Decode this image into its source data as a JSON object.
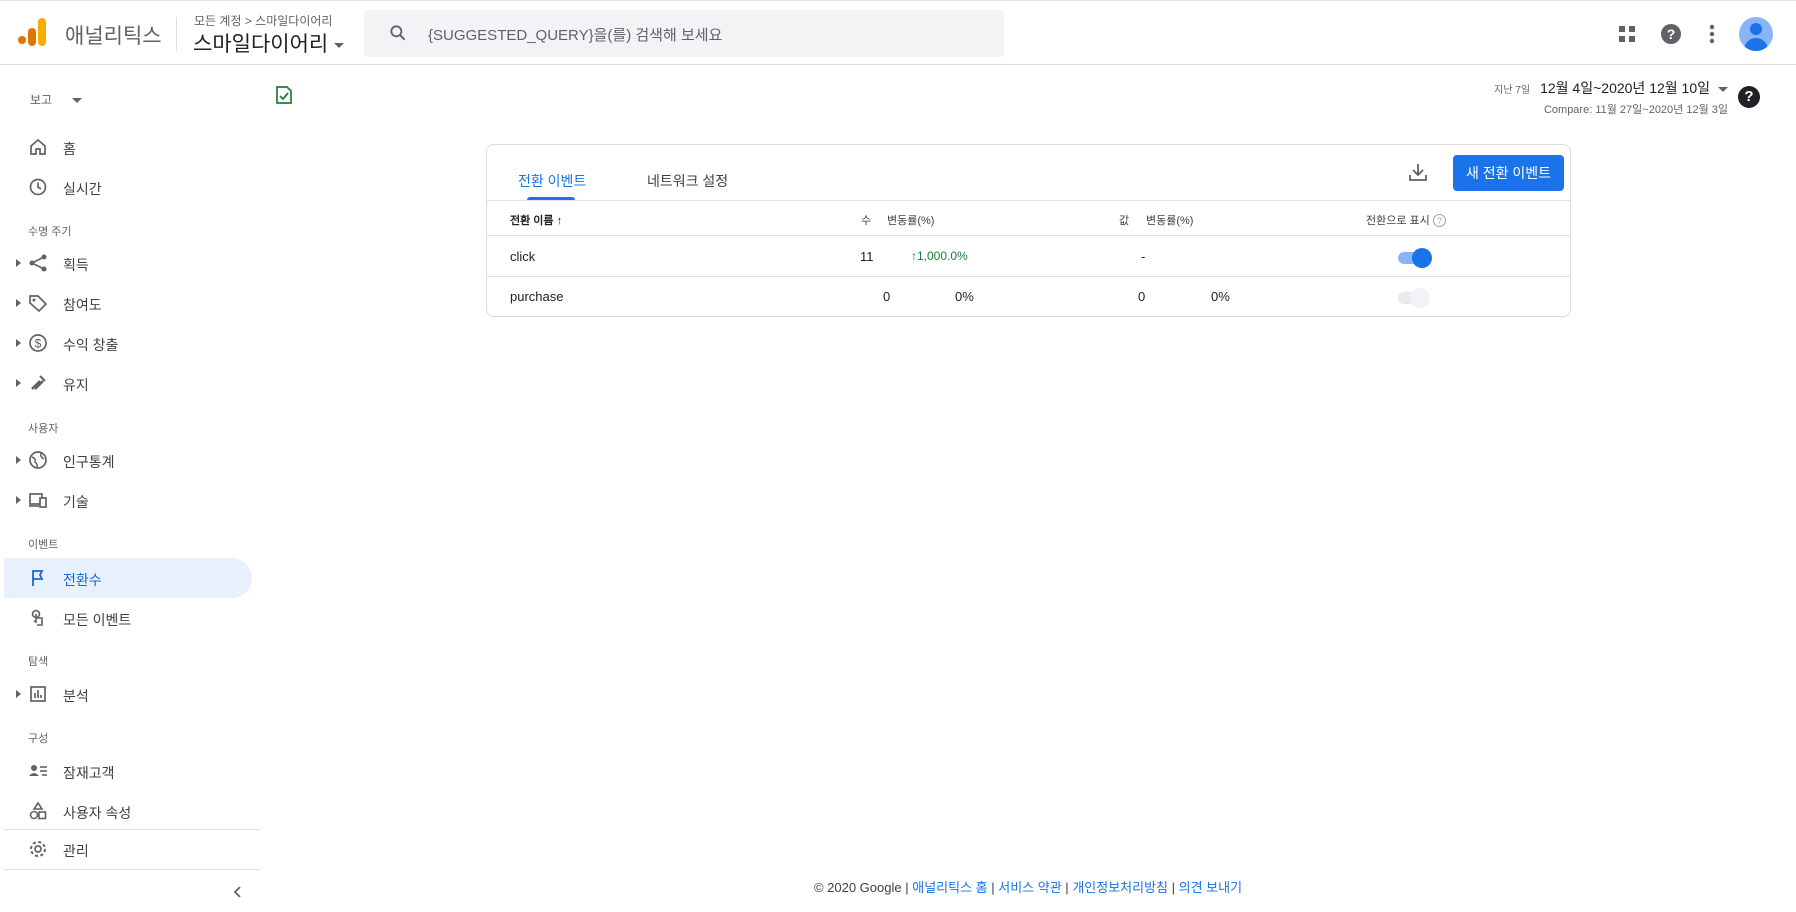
{
  "header": {
    "app_name": "애널리틱스",
    "breadcrumb": "모든 계정 > 스마일다이어리",
    "property": "스마일다이어리",
    "search_placeholder": "{SUGGESTED_QUERY}을(를) 검색해 보세요"
  },
  "sidebar": {
    "report_label": "보고",
    "home": "홈",
    "realtime": "실시간",
    "section_lifecycle": "수명 주기",
    "acquisition": "획득",
    "engagement": "참여도",
    "monetization": "수익 창출",
    "retention": "유지",
    "section_user": "사용자",
    "demographics": "인구통계",
    "tech": "기술",
    "section_events": "이벤트",
    "conversions": "전환수",
    "all_events": "모든 이벤트",
    "section_explore": "탐색",
    "analysis": "분석",
    "section_configure": "구성",
    "audiences": "잠재고객",
    "user_properties": "사용자 속성",
    "admin": "관리"
  },
  "date": {
    "range_label": "지난 7일",
    "range": "12월 4일~2020년 12월 10일",
    "compare": "Compare: 11월 27일~2020년 12월 3일"
  },
  "card": {
    "tab_conversions": "전환 이벤트",
    "tab_network": "네트워크 설정",
    "new_button": "새 전환 이벤트",
    "columns": {
      "name": "전환 이름",
      "count": "수",
      "change1": "변동률(%)",
      "value": "값",
      "change2": "변동률(%)",
      "mark": "전환으로 표시"
    },
    "rows": [
      {
        "name": "click",
        "count": "11",
        "change1": "1,000.0%",
        "value": "-",
        "change2": "",
        "marked": true
      },
      {
        "name": "purchase",
        "count": "0",
        "change1": "0%",
        "value": "0",
        "change2": "0%",
        "marked": false
      }
    ]
  },
  "footer": {
    "copyright": "© 2020 Google",
    "sep": "|",
    "link_home": "애널리틱스 홈",
    "link_terms": "서비스 약관",
    "link_privacy": "개인정보처리방침",
    "link_feedback": "의견 보내기"
  },
  "colors": {
    "accent": "#1a73e8",
    "active_bg": "#e8f0fe",
    "positive": "#188038"
  }
}
